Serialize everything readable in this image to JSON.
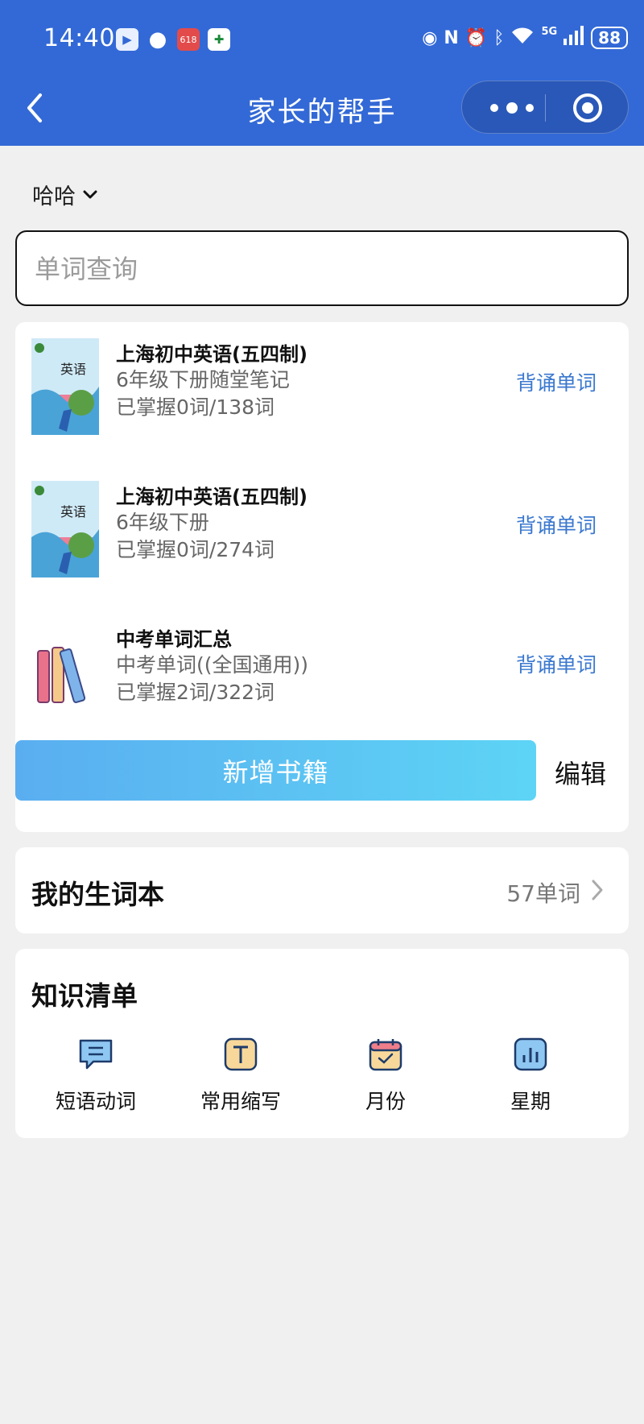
{
  "status_bar": {
    "time": "14:40",
    "battery": "88",
    "network": "5G"
  },
  "nav": {
    "title": "家长的帮手"
  },
  "user": {
    "name": "哈哈"
  },
  "search": {
    "placeholder": "单词查询"
  },
  "books": [
    {
      "title": "上海初中英语(五四制)",
      "subtitle": "6年级下册随堂笔记",
      "progress": "已掌握0词/138词",
      "action": "背诵单词",
      "cover": "english-textbook-cover"
    },
    {
      "title": "上海初中英语(五四制)",
      "subtitle": "6年级下册",
      "progress": "已掌握0词/274词",
      "action": "背诵单词",
      "cover": "english-textbook-cover"
    },
    {
      "title": "中考单词汇总",
      "subtitle": "中考单词((全国通用))",
      "progress": "已掌握2词/322词",
      "action": "背诵单词",
      "cover": "books-stack-icon"
    }
  ],
  "book_actions": {
    "add": "新增书籍",
    "edit": "编辑"
  },
  "vocab": {
    "title": "我的生词本",
    "count": "57单词"
  },
  "knowledge": {
    "title": "知识清单",
    "items": [
      {
        "label": "短语动词",
        "icon": "chat-list-icon"
      },
      {
        "label": "常用缩写",
        "icon": "letter-t-icon"
      },
      {
        "label": "月份",
        "icon": "calendar-icon"
      },
      {
        "label": "星期",
        "icon": "bar-chart-icon"
      }
    ]
  },
  "colors": {
    "header": "#3369d6",
    "accent_link": "#3b78cf",
    "add_button_from": "#5aaef0",
    "add_button_to": "#5dd4f5"
  }
}
